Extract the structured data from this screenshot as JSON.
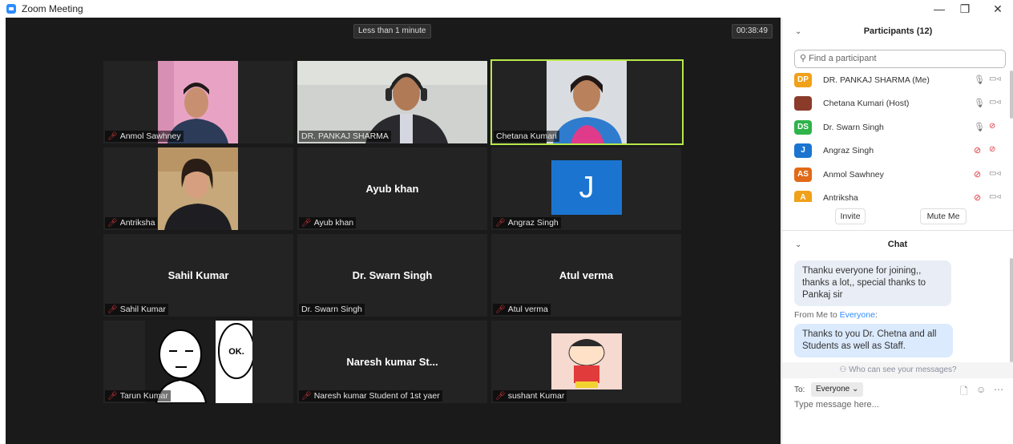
{
  "window": {
    "title": "Zoom Meeting",
    "minimize": "—",
    "restore": "❐",
    "close": "✕"
  },
  "video": {
    "time_badge": "Less than 1 minute",
    "duration": "00:38:49",
    "tiles": [
      {
        "name": "Anmol Sawhney",
        "center": "",
        "muted": true
      },
      {
        "name": "DR. PANKAJ SHARMA",
        "center": "",
        "muted": false
      },
      {
        "name": "Chetana Kumari",
        "center": "",
        "muted": false
      },
      {
        "name": "Antriksha",
        "center": "",
        "muted": true
      },
      {
        "name": "Ayub khan",
        "center": "Ayub khan",
        "muted": true
      },
      {
        "name": "Angraz Singh",
        "center": "",
        "muted": true,
        "avatar_letter": "J"
      },
      {
        "name": "Sahil Kumar",
        "center": "Sahil Kumar",
        "muted": true
      },
      {
        "name": "Dr. Swarn Singh",
        "center": "Dr. Swarn Singh",
        "muted": false
      },
      {
        "name": "Atul verma",
        "center": "Atul verma",
        "muted": true
      },
      {
        "name": "Tarun Kumar",
        "center": "",
        "muted": true,
        "comic_text": "OK."
      },
      {
        "name": "Naresh kumar Student of 1st yaer",
        "center": "Naresh kumar St...",
        "muted": true
      },
      {
        "name": "sushant Kumar",
        "center": "",
        "muted": true
      }
    ]
  },
  "participants": {
    "title": "Participants (12)",
    "search_placeholder": "Find a participant",
    "list": [
      {
        "initials": "DP",
        "name": "DR. PANKAJ SHARMA (Me)",
        "color": "#f0a019",
        "mic": "on",
        "cam": "on"
      },
      {
        "initials": "",
        "name": "Chetana Kumari (Host)",
        "color": "#8b3b2a",
        "mic": "on",
        "cam": "on"
      },
      {
        "initials": "DS",
        "name": "Dr. Swarn Singh",
        "color": "#2fb34a",
        "mic": "on",
        "cam": "off"
      },
      {
        "initials": "J",
        "name": "Angraz Singh",
        "color": "#1b75d0",
        "mic": "off",
        "cam": "off"
      },
      {
        "initials": "AS",
        "name": "Anmol Sawhney",
        "color": "#e06a18",
        "mic": "off",
        "cam": "on"
      },
      {
        "initials": "A",
        "name": "Antriksha",
        "color": "#f0a019",
        "mic": "off",
        "cam": "on"
      }
    ],
    "invite_label": "Invite",
    "mute_me_label": "Mute Me"
  },
  "chat": {
    "title": "Chat",
    "messages": [
      {
        "text": "Thanku everyone for joining,, thanks a lot,, special thanks to  Pankaj sir"
      }
    ],
    "from_prefix": "From Me to ",
    "from_target": "Everyone",
    "from_suffix": ":",
    "my_message": "Thanks to you Dr. Chetna and all Students as well as Staff.",
    "who_can_see": "Who can see your messages?",
    "to_label": "To:",
    "to_value": "Everyone",
    "input_placeholder": "Type message here..."
  }
}
